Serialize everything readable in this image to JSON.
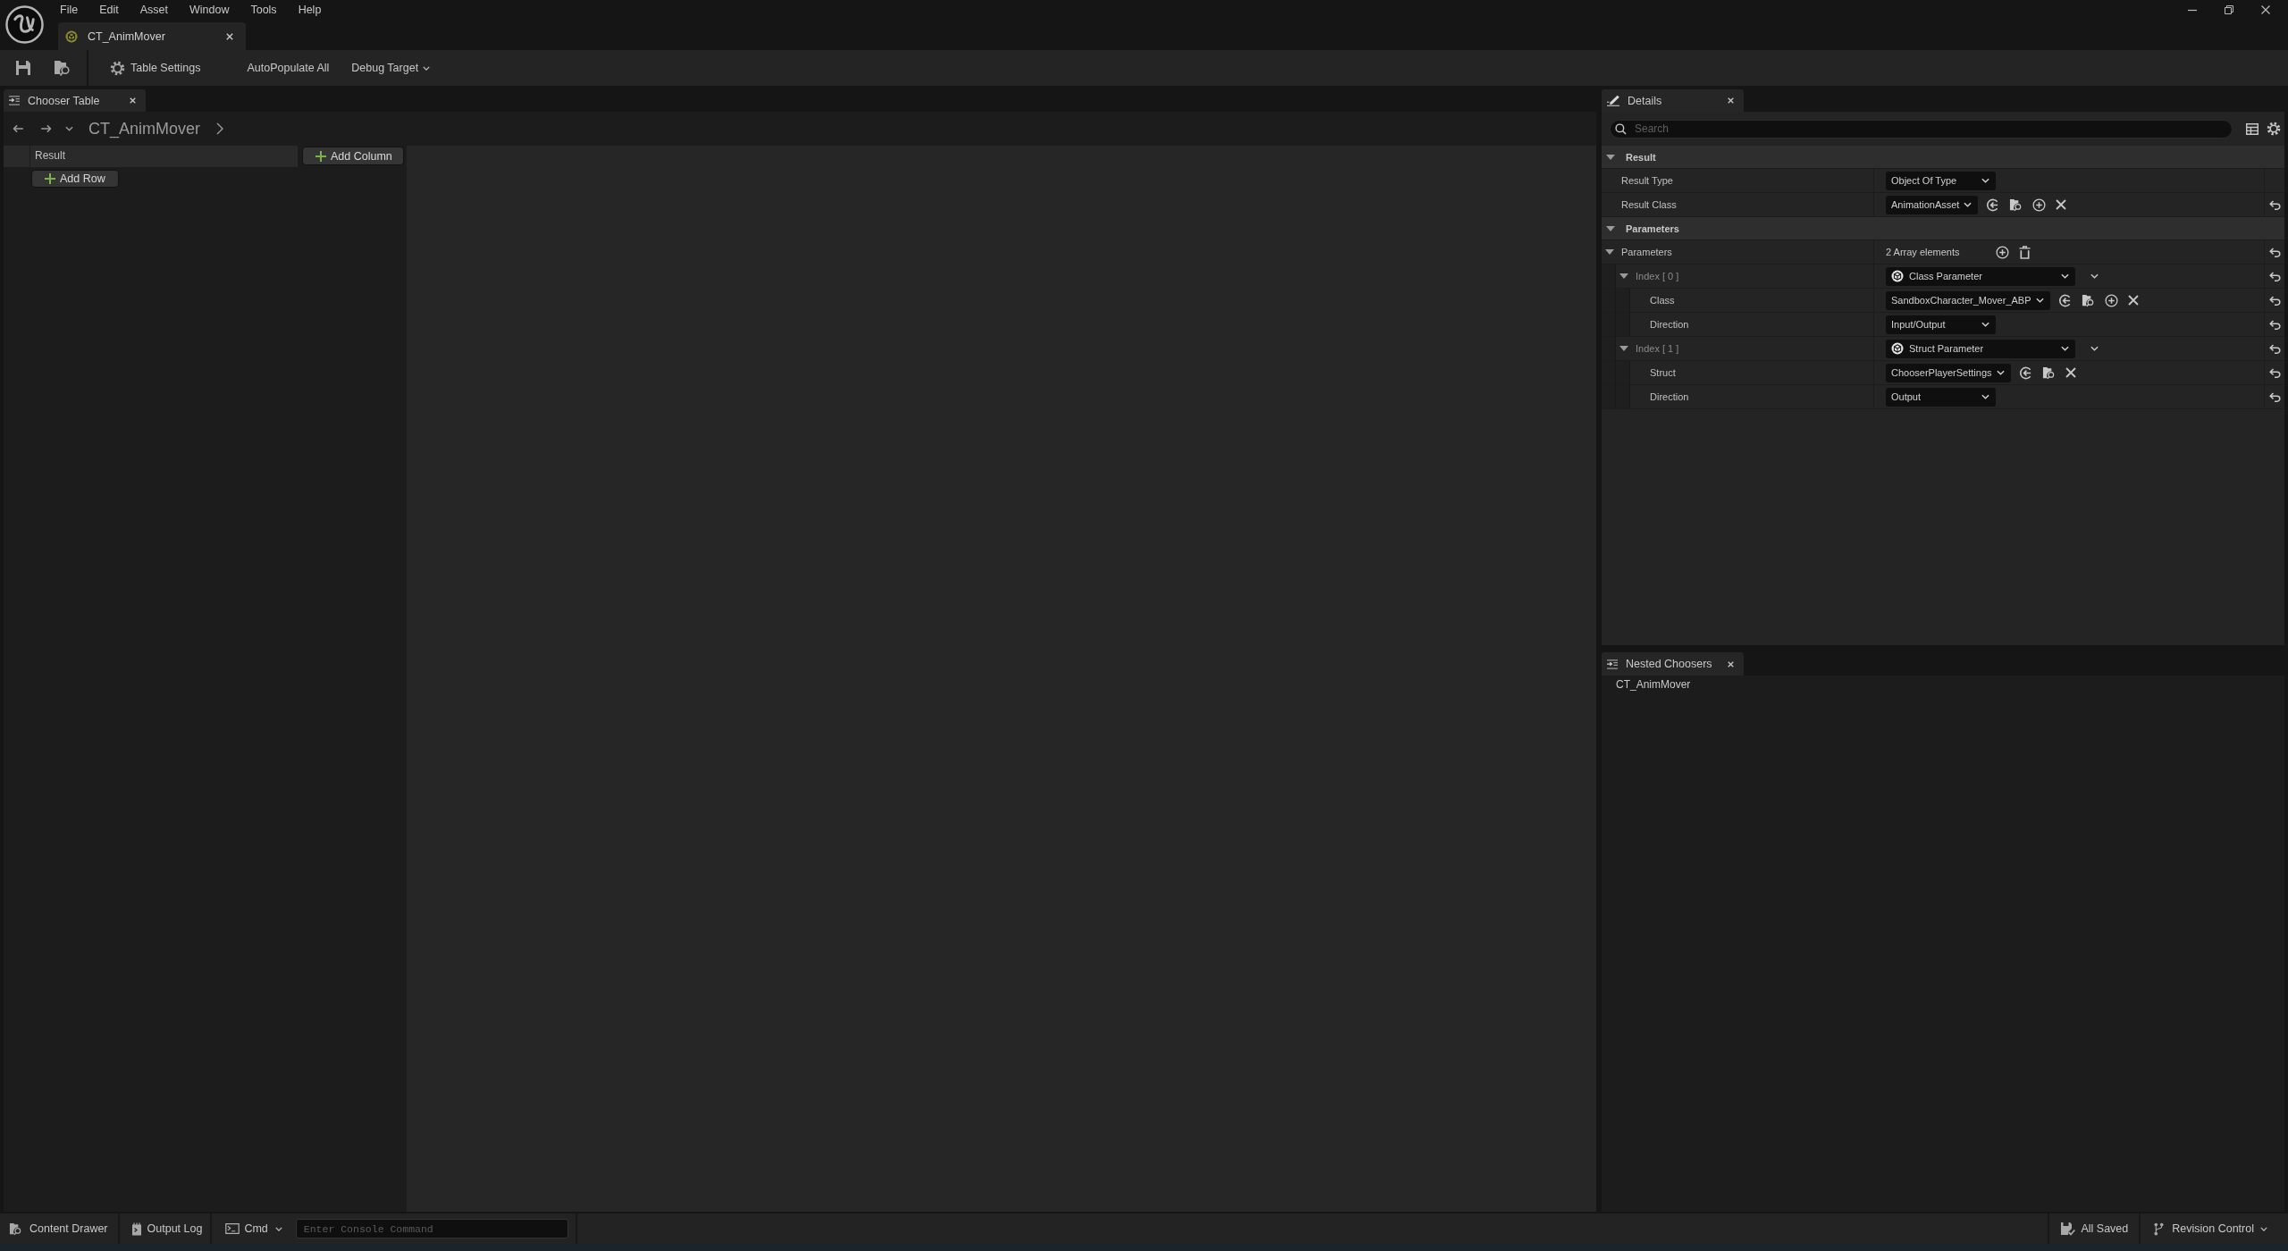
{
  "menu_bar": {
    "items": [
      "File",
      "Edit",
      "Asset",
      "Window",
      "Tools",
      "Help"
    ]
  },
  "document_tab": {
    "title": "CT_AnimMover"
  },
  "toolbar": {
    "table_settings": "Table Settings",
    "autopopulate": "AutoPopulate All",
    "debug_target": "Debug Target"
  },
  "chooser_table": {
    "tab": "Chooser Table",
    "breadcrumb": "CT_AnimMover",
    "columns": [
      "Result"
    ],
    "add_column": "Add Column",
    "add_row": "Add Row"
  },
  "details": {
    "tab": "Details",
    "search": {
      "placeholder": "Search"
    },
    "categories": [
      {
        "label": "Result",
        "expanded": true,
        "rows": [
          {
            "label": "Result Type",
            "kind": "combo",
            "value": "Object Of Type"
          },
          {
            "label": "Result Class",
            "kind": "asset",
            "value": "AnimationAsset",
            "can_create": true,
            "reset": true
          }
        ]
      },
      {
        "label": "Parameters",
        "expanded": true,
        "rows": [
          {
            "label": "Parameters",
            "kind": "array",
            "value": "2 Array elements",
            "reset": true,
            "expanded": true,
            "children": [
              {
                "label": "Index [ 0 ]",
                "kind": "instanced",
                "value": "Class Parameter",
                "reset": true,
                "expanded": true,
                "children": [
                  {
                    "label": "Class",
                    "kind": "asset",
                    "value": "SandboxCharacter_Mover_ABP",
                    "can_create": true,
                    "reset": true
                  },
                  {
                    "label": "Direction",
                    "kind": "combo",
                    "value": "Input/Output",
                    "reset": true
                  }
                ]
              },
              {
                "label": "Index [ 1 ]",
                "kind": "instanced",
                "value": "Struct Parameter",
                "reset": true,
                "expanded": true,
                "children": [
                  {
                    "label": "Struct",
                    "kind": "asset",
                    "value": "ChooserPlayerSettings",
                    "reset": true
                  },
                  {
                    "label": "Direction",
                    "kind": "combo",
                    "value": "Output",
                    "reset": true
                  }
                ]
              }
            ]
          }
        ]
      }
    ]
  },
  "nested_choosers": {
    "tab": "Nested Choosers",
    "items": [
      "CT_AnimMover"
    ]
  },
  "status_bar": {
    "content_drawer": "Content Drawer",
    "output_log": "Output Log",
    "console": {
      "label": "Cmd",
      "placeholder": "Enter Console Command"
    },
    "save_status": "All Saved",
    "revision_control": "Revision Control"
  }
}
